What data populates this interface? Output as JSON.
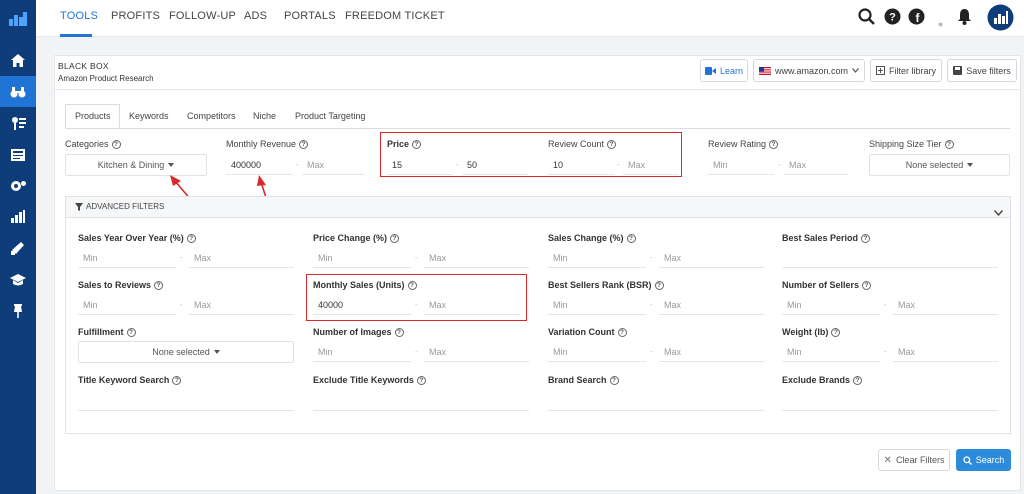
{
  "topnav": {
    "tabs": [
      {
        "label": "TOOLS",
        "active": true
      },
      {
        "label": "PROFITS",
        "active": false
      },
      {
        "label": "FOLLOW-UP",
        "active": false
      },
      {
        "label": "ADS",
        "active": false
      },
      {
        "label": "PORTALS",
        "active": false
      },
      {
        "label": "FREEDOM TICKET",
        "active": false
      }
    ],
    "icons": [
      "search-icon",
      "help-icon",
      "facebook-icon",
      "bell-icon",
      "avatar"
    ]
  },
  "sidebar": {
    "icons": [
      "logo-icon",
      "home-icon",
      "binoculars-icon",
      "keywords-icon",
      "listing-icon",
      "settings-icon",
      "analytics-icon",
      "megaphone-icon",
      "academy-icon",
      "pin-icon"
    ]
  },
  "header": {
    "title": "BLACK BOX",
    "subtitle": "Amazon Product Research",
    "learn": "Learn",
    "marketplace": "www.amazon.com",
    "filter_library": "Filter library",
    "save_filters": "Save filters"
  },
  "subtabs": [
    "Products",
    "Keywords",
    "Competitors",
    "Niche",
    "Product Targeting"
  ],
  "filters": {
    "categories": {
      "label": "Categories",
      "value": "Kitchen & Dining"
    },
    "monthly_revenue": {
      "label": "Monthly Revenue",
      "min": "400000",
      "max": "Max"
    },
    "price": {
      "label": "Price",
      "min": "15",
      "max": "50"
    },
    "review_count": {
      "label": "Review Count",
      "min": "10",
      "max": "Max"
    },
    "review_rating": {
      "label": "Review Rating",
      "min": "Min",
      "max": "Max"
    },
    "shipping_size": {
      "label": "Shipping Size Tier",
      "value": "None selected"
    }
  },
  "advanced": {
    "title": "ADVANCED FILTERS",
    "sales_yoy": {
      "label": "Sales Year Over Year (%)",
      "min": "Min",
      "max": "Max"
    },
    "price_change": {
      "label": "Price Change (%)",
      "min": "Min",
      "max": "Max"
    },
    "sales_change": {
      "label": "Sales Change (%)",
      "min": "Min",
      "max": "Max"
    },
    "best_sales_period": {
      "label": "Best Sales Period"
    },
    "sales_to_reviews": {
      "label": "Sales to Reviews",
      "min": "Min",
      "max": "Max"
    },
    "monthly_sales": {
      "label": "Monthly Sales (Units)",
      "min": "40000",
      "max": "Max"
    },
    "bsr": {
      "label": "Best Sellers Rank (BSR)",
      "min": "Min",
      "max": "Max"
    },
    "num_sellers": {
      "label": "Number of Sellers",
      "min": "Min",
      "max": "Max"
    },
    "fulfillment": {
      "label": "Fulfillment",
      "value": "None selected"
    },
    "num_images": {
      "label": "Number of Images",
      "min": "Min",
      "max": "Max"
    },
    "variation_count": {
      "label": "Variation Count",
      "min": "Min",
      "max": "Max"
    },
    "weight": {
      "label": "Weight (lb)",
      "min": "Min",
      "max": "Max"
    },
    "title_keyword": {
      "label": "Title Keyword Search"
    },
    "exclude_title": {
      "label": "Exclude Title Keywords"
    },
    "brand_search": {
      "label": "Brand Search"
    },
    "exclude_brands": {
      "label": "Exclude Brands"
    }
  },
  "actions": {
    "clear": "Clear Filters",
    "search": "Search"
  },
  "colors": {
    "primary": "#1f74d6",
    "sidebar": "#0f3d7a",
    "highlight": "#d9292b"
  }
}
